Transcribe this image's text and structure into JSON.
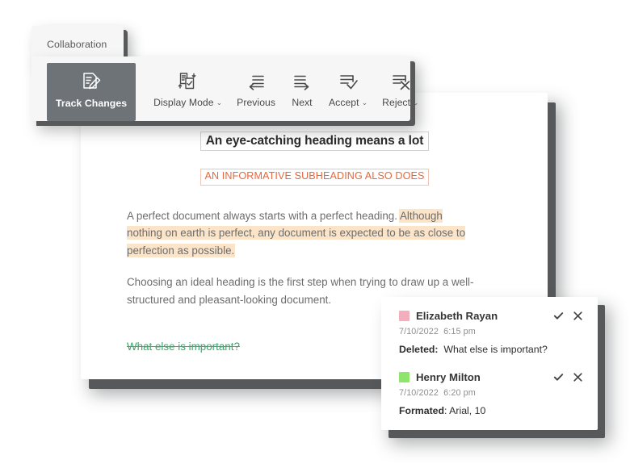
{
  "tab": {
    "label": "Collaboration"
  },
  "toolbar": {
    "items": [
      {
        "label": "Track Changes",
        "icon": "document-pencil-icon",
        "active": true,
        "caret": false
      },
      {
        "label": "Display Mode",
        "icon": "document-checklist-icon",
        "active": false,
        "caret": true
      },
      {
        "label": "Previous",
        "icon": "arrow-left-document-icon",
        "active": false,
        "caret": false
      },
      {
        "label": "Next",
        "icon": "arrow-right-document-icon",
        "active": false,
        "caret": false
      },
      {
        "label": "Accept",
        "icon": "document-check-icon",
        "active": false,
        "caret": true
      },
      {
        "label": "Reject",
        "icon": "document-x-icon",
        "active": false,
        "caret": true
      }
    ],
    "caret_glyph": "⌄",
    "active_bg": "#6e7377"
  },
  "document": {
    "heading": "An eye-catching heading means a lot",
    "subheading": "AN INFORMATIVE SUBHEADING ALSO DOES",
    "subheading_color": "#e8673c",
    "paragraph1_plain": "A perfect document always starts with a perfect heading. ",
    "paragraph1_highlight": "Although nothing on earth is perfect, any document is expected to be as close to perfection as possible.",
    "highlight_color": "#fbe4c7",
    "paragraph2": "Choosing an ideal heading is the first step when trying to draw up a well-structured and pleasant-looking document.",
    "deleted_line": "What else  is important?",
    "deleted_color": "#3aa86a"
  },
  "comments": [
    {
      "author": "Elizabeth Rayan",
      "swatch_color": "#f2aebc",
      "date": "7/10/2022",
      "time": "6:15 pm",
      "change_type": "Deleted:",
      "change_value": "What else is important?",
      "accept_icon": "check-icon",
      "reject_icon": "close-icon"
    },
    {
      "author": "Henry Milton",
      "swatch_color": "#8ee56c",
      "date": "7/10/2022",
      "time": "6:20 pm",
      "change_type": "Formated",
      "change_value": ": Arial, 10",
      "accept_icon": "check-icon",
      "reject_icon": "close-icon"
    }
  ]
}
